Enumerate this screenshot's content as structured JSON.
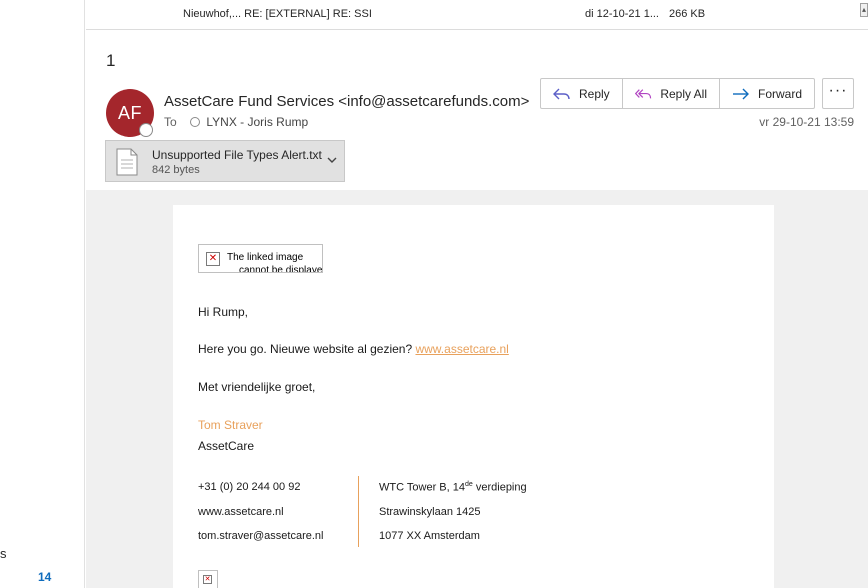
{
  "left_pane": {
    "fragment": "s",
    "count": "14"
  },
  "list_row": {
    "subject": "Nieuwhof,... RE: [EXTERNAL] RE: SSI",
    "date": "di 12-10-21 1...",
    "size": "266 KB"
  },
  "reading": {
    "message_count": "1",
    "avatar_initials": "AF",
    "sender": "AssetCare Fund Services <info@assetcarefunds.com>",
    "to_label": "To",
    "recipient": "LYNX - Joris Rump",
    "timestamp": "vr 29-10-21 13:59",
    "actions": {
      "reply": "Reply",
      "reply_all": "Reply All",
      "forward": "Forward",
      "more": "···"
    },
    "attachment": {
      "name": "Unsupported File Types Alert.txt",
      "size": "842 bytes"
    }
  },
  "body": {
    "broken_image_alt": "The linked image",
    "broken_image_alt_2": "cannot be displayed.",
    "greeting": "Hi Rump,",
    "line1": "Here you go. Nieuwe website al gezien?",
    "line1_link": "www.assetcare.nl",
    "closing": "Met vriendelijke groet,",
    "sig_name": "Tom Straver",
    "sig_company": "AssetCare",
    "phone": "+31 (0) 20 244 00 92",
    "website": "www.assetcare.nl",
    "email": "tom.straver@assetcare.nl",
    "address1_pre": "WTC Tower B, 14",
    "address1_sup": "de",
    "address1_post": " verdieping",
    "address2": "Strawinskylaan 1425",
    "address3": "1077 XX Amsterdam"
  },
  "colors": {
    "avatar_bg": "#a4262c",
    "accent_orange": "#e8a15c",
    "body_bg": "#f0f0f0"
  }
}
